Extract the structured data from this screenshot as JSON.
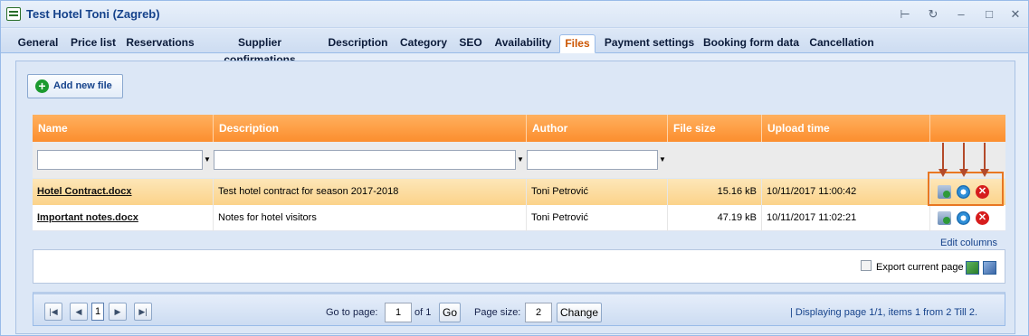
{
  "window": {
    "title": "Test Hotel Toni (Zagreb)",
    "icons": [
      "form-window-icon",
      "pin-icon",
      "refresh-icon",
      "minimize-icon",
      "maximize-icon",
      "close-icon"
    ]
  },
  "tabs": [
    {
      "label": "General",
      "active": false
    },
    {
      "label": "Price list",
      "active": false
    },
    {
      "label": "Reservations",
      "active": false
    },
    {
      "label": "Supplier confirmations",
      "active": false
    },
    {
      "label": "Description",
      "active": false
    },
    {
      "label": "Category",
      "active": false
    },
    {
      "label": "SEO",
      "active": false
    },
    {
      "label": "Availability",
      "active": false
    },
    {
      "label": "Files",
      "active": true
    },
    {
      "label": "Payment settings",
      "active": false
    },
    {
      "label": "Booking form data",
      "active": false
    },
    {
      "label": "Cancellation",
      "active": false
    }
  ],
  "toolbar": {
    "add_label": "Add new file"
  },
  "grid": {
    "columns": [
      "Name",
      "Description",
      "Author",
      "File size",
      "Upload time",
      ""
    ],
    "filters": {
      "name": "",
      "description": "",
      "author": ""
    },
    "rows": [
      {
        "name": "Hotel Contract.docx",
        "description": "Test hotel contract for season 2017-2018",
        "author": "Toni Petrović",
        "size": "15.16 kB",
        "uploaded": "10/11/2017 11:00:42",
        "selected": true
      },
      {
        "name": "Important notes.docx",
        "description": "Notes for hotel visitors",
        "author": "Toni Petrović",
        "size": "47.19 kB",
        "uploaded": "10/11/2017 11:02:21",
        "selected": false
      }
    ],
    "row_actions": [
      "download-icon",
      "settings-gear-icon",
      "delete-icon"
    ],
    "edit_columns_label": "Edit columns"
  },
  "export": {
    "label": "Export current page",
    "checked": false
  },
  "pager": {
    "current_page": "1",
    "goto_label": "Go to page:",
    "goto_value": "1",
    "of_label": "of 1",
    "go_label": "Go",
    "page_size_label": "Page size:",
    "page_size_value": "2",
    "change_label": "Change",
    "info": "| Displaying page  1/1,  items  1  from  2  Till  2."
  },
  "colors": {
    "header_orange": "#fc8e2e",
    "highlight": "#e87722",
    "arrow": "#b34a2a",
    "tab_active_text": "#cc5500"
  }
}
